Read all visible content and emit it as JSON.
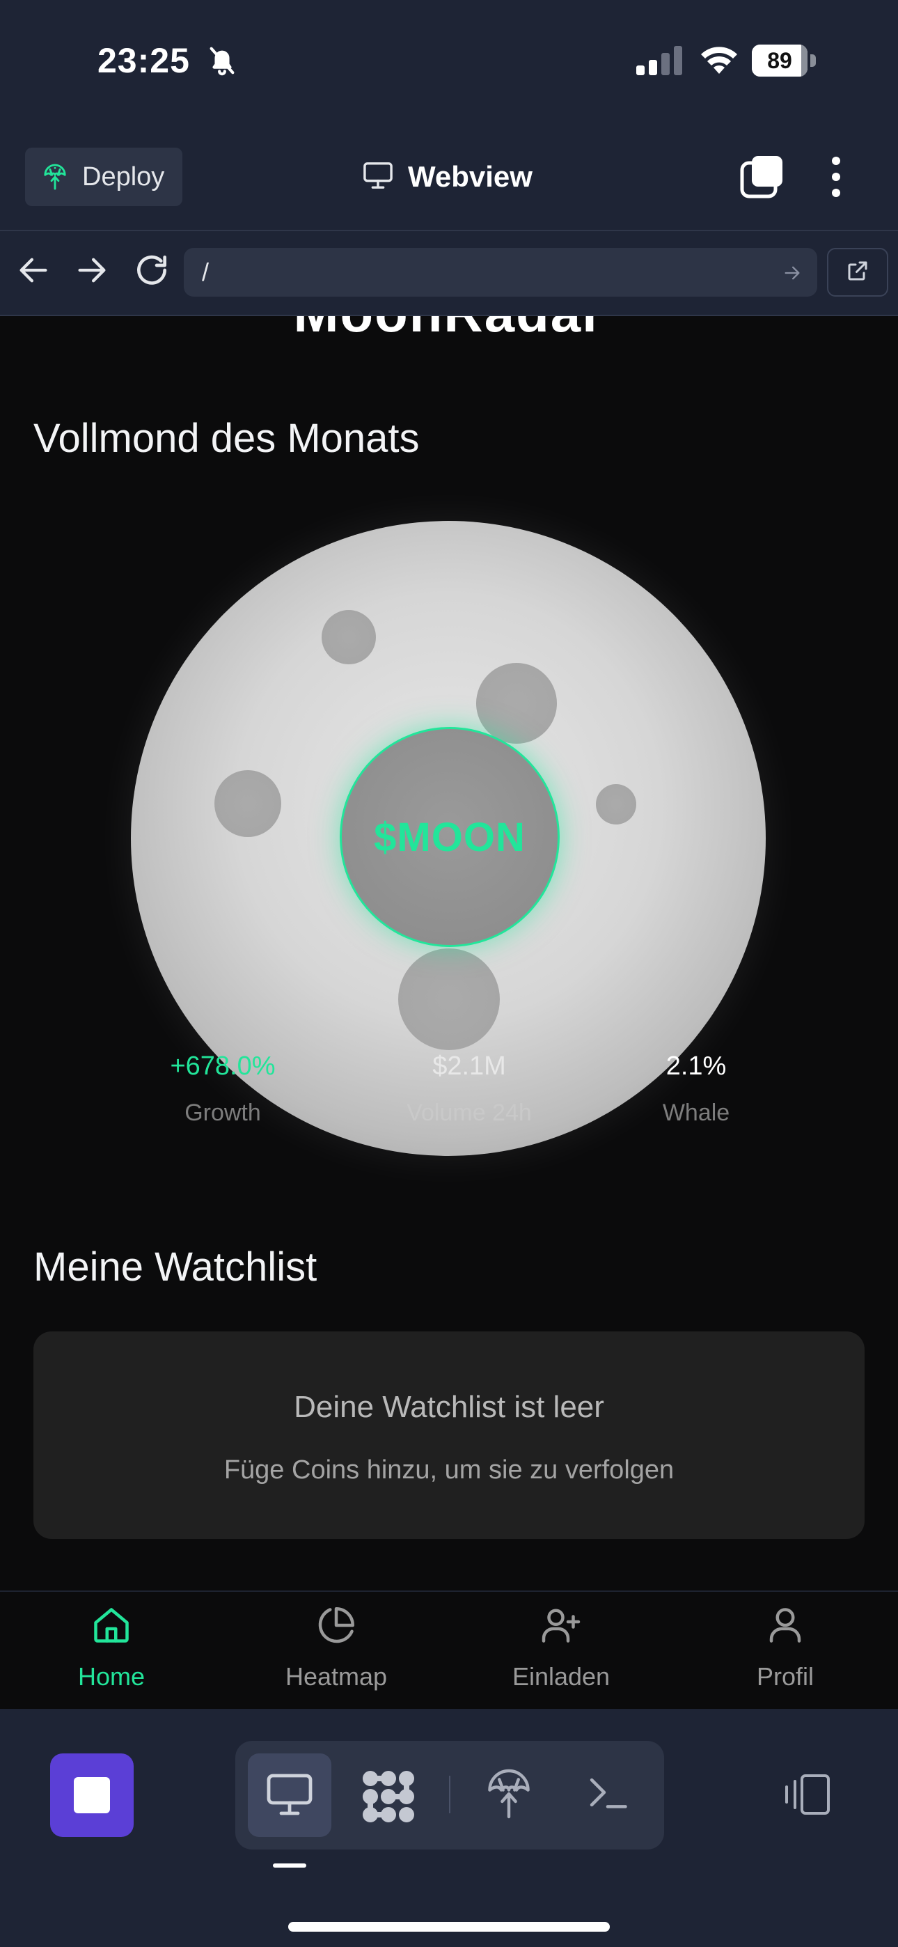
{
  "status_bar": {
    "time": "23:25",
    "battery_percent": "89",
    "battery_level": 0.89,
    "icons": [
      "bell-slash-icon",
      "cellular-signal-icon",
      "wifi-icon",
      "battery-icon"
    ]
  },
  "top_bar": {
    "deploy_label": "Deploy",
    "title": "Webview",
    "icons": [
      "deploy-icon",
      "monitor-icon",
      "tabs-icon",
      "more-vertical-icon"
    ]
  },
  "url_bar": {
    "url": "/",
    "icons": [
      "arrow-left-icon",
      "arrow-right-icon",
      "reload-icon",
      "go-arrow-icon",
      "external-link-icon"
    ]
  },
  "page": {
    "brand": "MoonRadar",
    "featured_title": "Vollmond des Monats",
    "token_symbol": "$MOON",
    "stats": [
      {
        "value": "+678.0%",
        "label": "Growth",
        "color": "#22e59a"
      },
      {
        "value": "$2.1M",
        "label": "Volume 24h",
        "color": "#e8e8e8"
      },
      {
        "value": "2.1%",
        "label": "Whale",
        "color": "#ffffff"
      }
    ],
    "watchlist_title": "Meine Watchlist",
    "watchlist_empty_title": "Deine Watchlist ist leer",
    "watchlist_empty_hint": "Füge Coins hinzu, um sie zu verfolgen"
  },
  "bottom_nav": {
    "items": [
      {
        "label": "Home",
        "icon": "home-icon",
        "active": true
      },
      {
        "label": "Heatmap",
        "icon": "pie-chart-icon",
        "active": false
      },
      {
        "label": "Einladen",
        "icon": "user-plus-icon",
        "active": false
      },
      {
        "label": "Profil",
        "icon": "user-icon",
        "active": false
      }
    ]
  },
  "dev_toolbar": {
    "icons": [
      "stop-icon",
      "monitor-icon",
      "apps-icon",
      "deploy-icon",
      "terminal-icon",
      "device-rotate-icon"
    ]
  },
  "colors": {
    "accent": "#22e59a",
    "chrome_bg": "#1e2435",
    "page_bg": "#0b0b0c",
    "stop_button": "#5b3fd6"
  }
}
